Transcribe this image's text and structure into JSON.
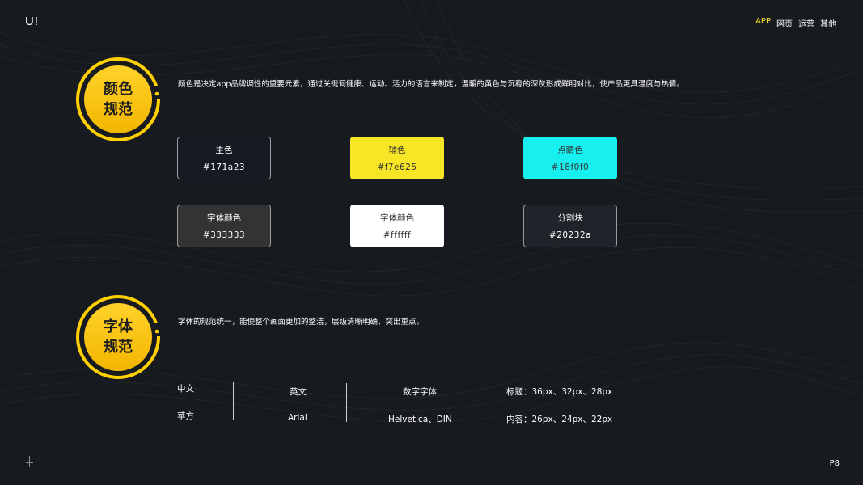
{
  "header": {
    "logo": "U!",
    "nav": [
      "APP",
      "网页",
      "运营",
      "其他"
    ],
    "active_index": 0
  },
  "color_section": {
    "title_line1": "颜色",
    "title_line2": "规范",
    "description": "颜色是决定app品牌调性的重要元素，通过关键词健康、运动、活力的语言来制定，温暖的黄色与沉稳的深灰形成鲜明对比，使产品更具温度与热情。",
    "swatches": [
      {
        "name": "主色",
        "hex": "#171a23",
        "bg": "#171a23",
        "text": "#ffffff"
      },
      {
        "name": "辅色",
        "hex": "#f7e625",
        "bg": "#f7e625",
        "text": "#333333"
      },
      {
        "name": "点睛色",
        "hex": "#18f0f0",
        "bg": "#18f0f0",
        "text": "#333333"
      },
      {
        "name": "字体颜色",
        "hex": "#333333",
        "bg": "#333333",
        "text": "#ffffff"
      },
      {
        "name": "字体颜色",
        "hex": "#ffffff",
        "bg": "#ffffff",
        "text": "#333333"
      },
      {
        "name": "分割块",
        "hex": "#20232a",
        "bg": "#20232a",
        "text": "#ffffff"
      }
    ]
  },
  "font_section": {
    "title_line1": "字体",
    "title_line2": "规范",
    "description": "字体的规范统一，能使整个画面更加的整洁，层级清晰明确，突出重点。",
    "chinese_label": "中文",
    "chinese_font": "苹方",
    "english_label": "英文",
    "english_font": "Arial",
    "number_label": "数字字体",
    "number_font": "Helvetica、DIN",
    "title_sizes": "标题：36px、32px、28px",
    "content_sizes": "内容：26px、24px、22px"
  },
  "footer": {
    "page": "P8"
  },
  "colors": {
    "accent": "#f7e625",
    "background": "#171a1e"
  }
}
